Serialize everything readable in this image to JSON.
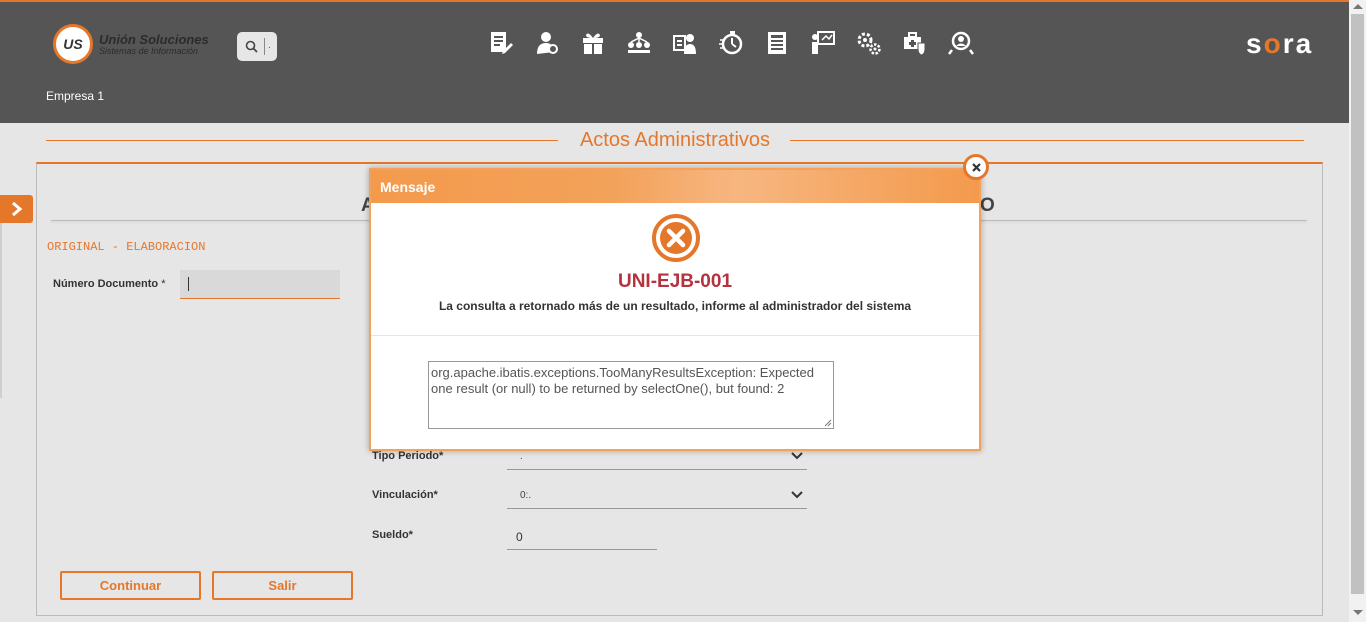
{
  "header": {
    "logo": {
      "mark": "US",
      "title": "Unión Soluciones",
      "subtitle": "Sistemas de Información"
    },
    "search": {
      "icon": "search-icon",
      "sep": "."
    },
    "nav_icons": [
      "document-edit-icon",
      "person-settings-icon",
      "gift-icon",
      "org-hierarchy-icon",
      "employee-card-icon",
      "stopwatch-icon",
      "report-list-icon",
      "presentation-icon",
      "gears-icon",
      "medical-kit-shield-icon",
      "people-search-icon"
    ],
    "brand": {
      "a": "s",
      "b": "o",
      "c": "ra"
    },
    "company": "Empresa 1"
  },
  "page": {
    "title": "Actos Administrativos",
    "subtitle": "ORIGINAL - ELABORACION",
    "hidden_title_start": "A",
    "hidden_title_end": "O",
    "fields": {
      "numero_documento": {
        "label": "Número Documento",
        "req": "*",
        "value": ""
      },
      "tipo_periodo": {
        "label": "Tipo Periodo*",
        "value": "."
      },
      "vinculacion": {
        "label": "Vinculación*",
        "value": "0:."
      },
      "sueldo": {
        "label": "Sueldo*",
        "value": "0"
      }
    },
    "buttons": {
      "continuar": "Continuar",
      "salir": "Salir"
    }
  },
  "modal": {
    "title": "Mensaje",
    "code": "UNI-EJB-001",
    "message": "La consulta a retornado más de un resultado, informe al administrador del sistema",
    "detail": "org.apache.ibatis.exceptions.TooManyResultsException: Expected one result (or null) to be returned by selectOne(), but found: 2"
  },
  "colors": {
    "accent": "#e5772b",
    "header_bg": "#555555",
    "error_code": "#b5323f"
  }
}
